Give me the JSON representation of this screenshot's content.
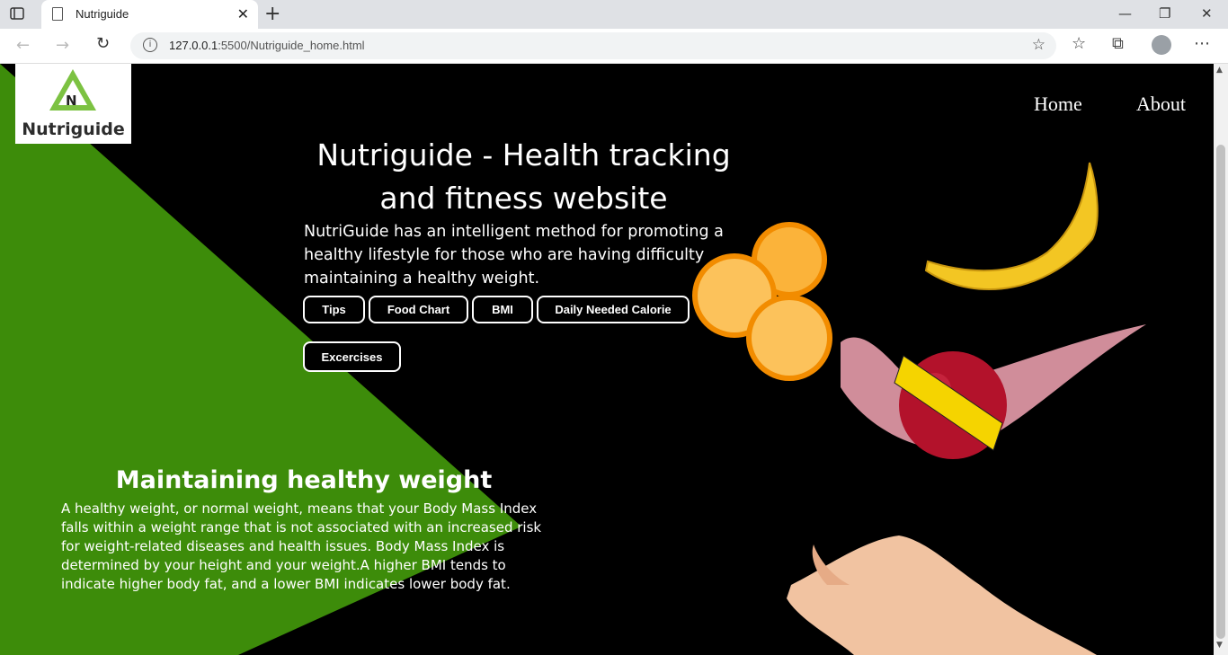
{
  "browser": {
    "tab_title": "Nutriguide",
    "tab_close": "✕",
    "new_tab": "+",
    "url_host": "127.0.0.1",
    "url_path": ":5500/Nutriguide_home.html",
    "window_controls": [
      "—",
      "❐",
      "✕"
    ]
  },
  "page": {
    "logo_text": "Nutriguide",
    "logo_letter": "N",
    "nav": [
      "Home",
      "About"
    ],
    "hero": {
      "title": "Nutriguide - Health tracking and fitness website",
      "text": "NutriGuide has an intelligent method for promoting a healthy lifestyle for those who are having difficulty maintaining a healthy weight."
    },
    "buttons": [
      "Tips",
      "Food Chart",
      "BMI",
      "Daily Needed Calorie",
      "Excercises"
    ],
    "section": {
      "title": "Maintaining healthy weight",
      "text": "A healthy weight, or normal weight, means that your Body Mass Index falls within a weight range that is not associated with an increased risk for weight-related diseases and health issues. Body Mass Index is determined by your height and your weight.A higher BMI tends to indicate higher body fat, and a lower BMI indicates lower body fat."
    }
  },
  "colors": {
    "green": "#3d8c0a",
    "logo_green": "#7cc242",
    "background": "#000000"
  }
}
